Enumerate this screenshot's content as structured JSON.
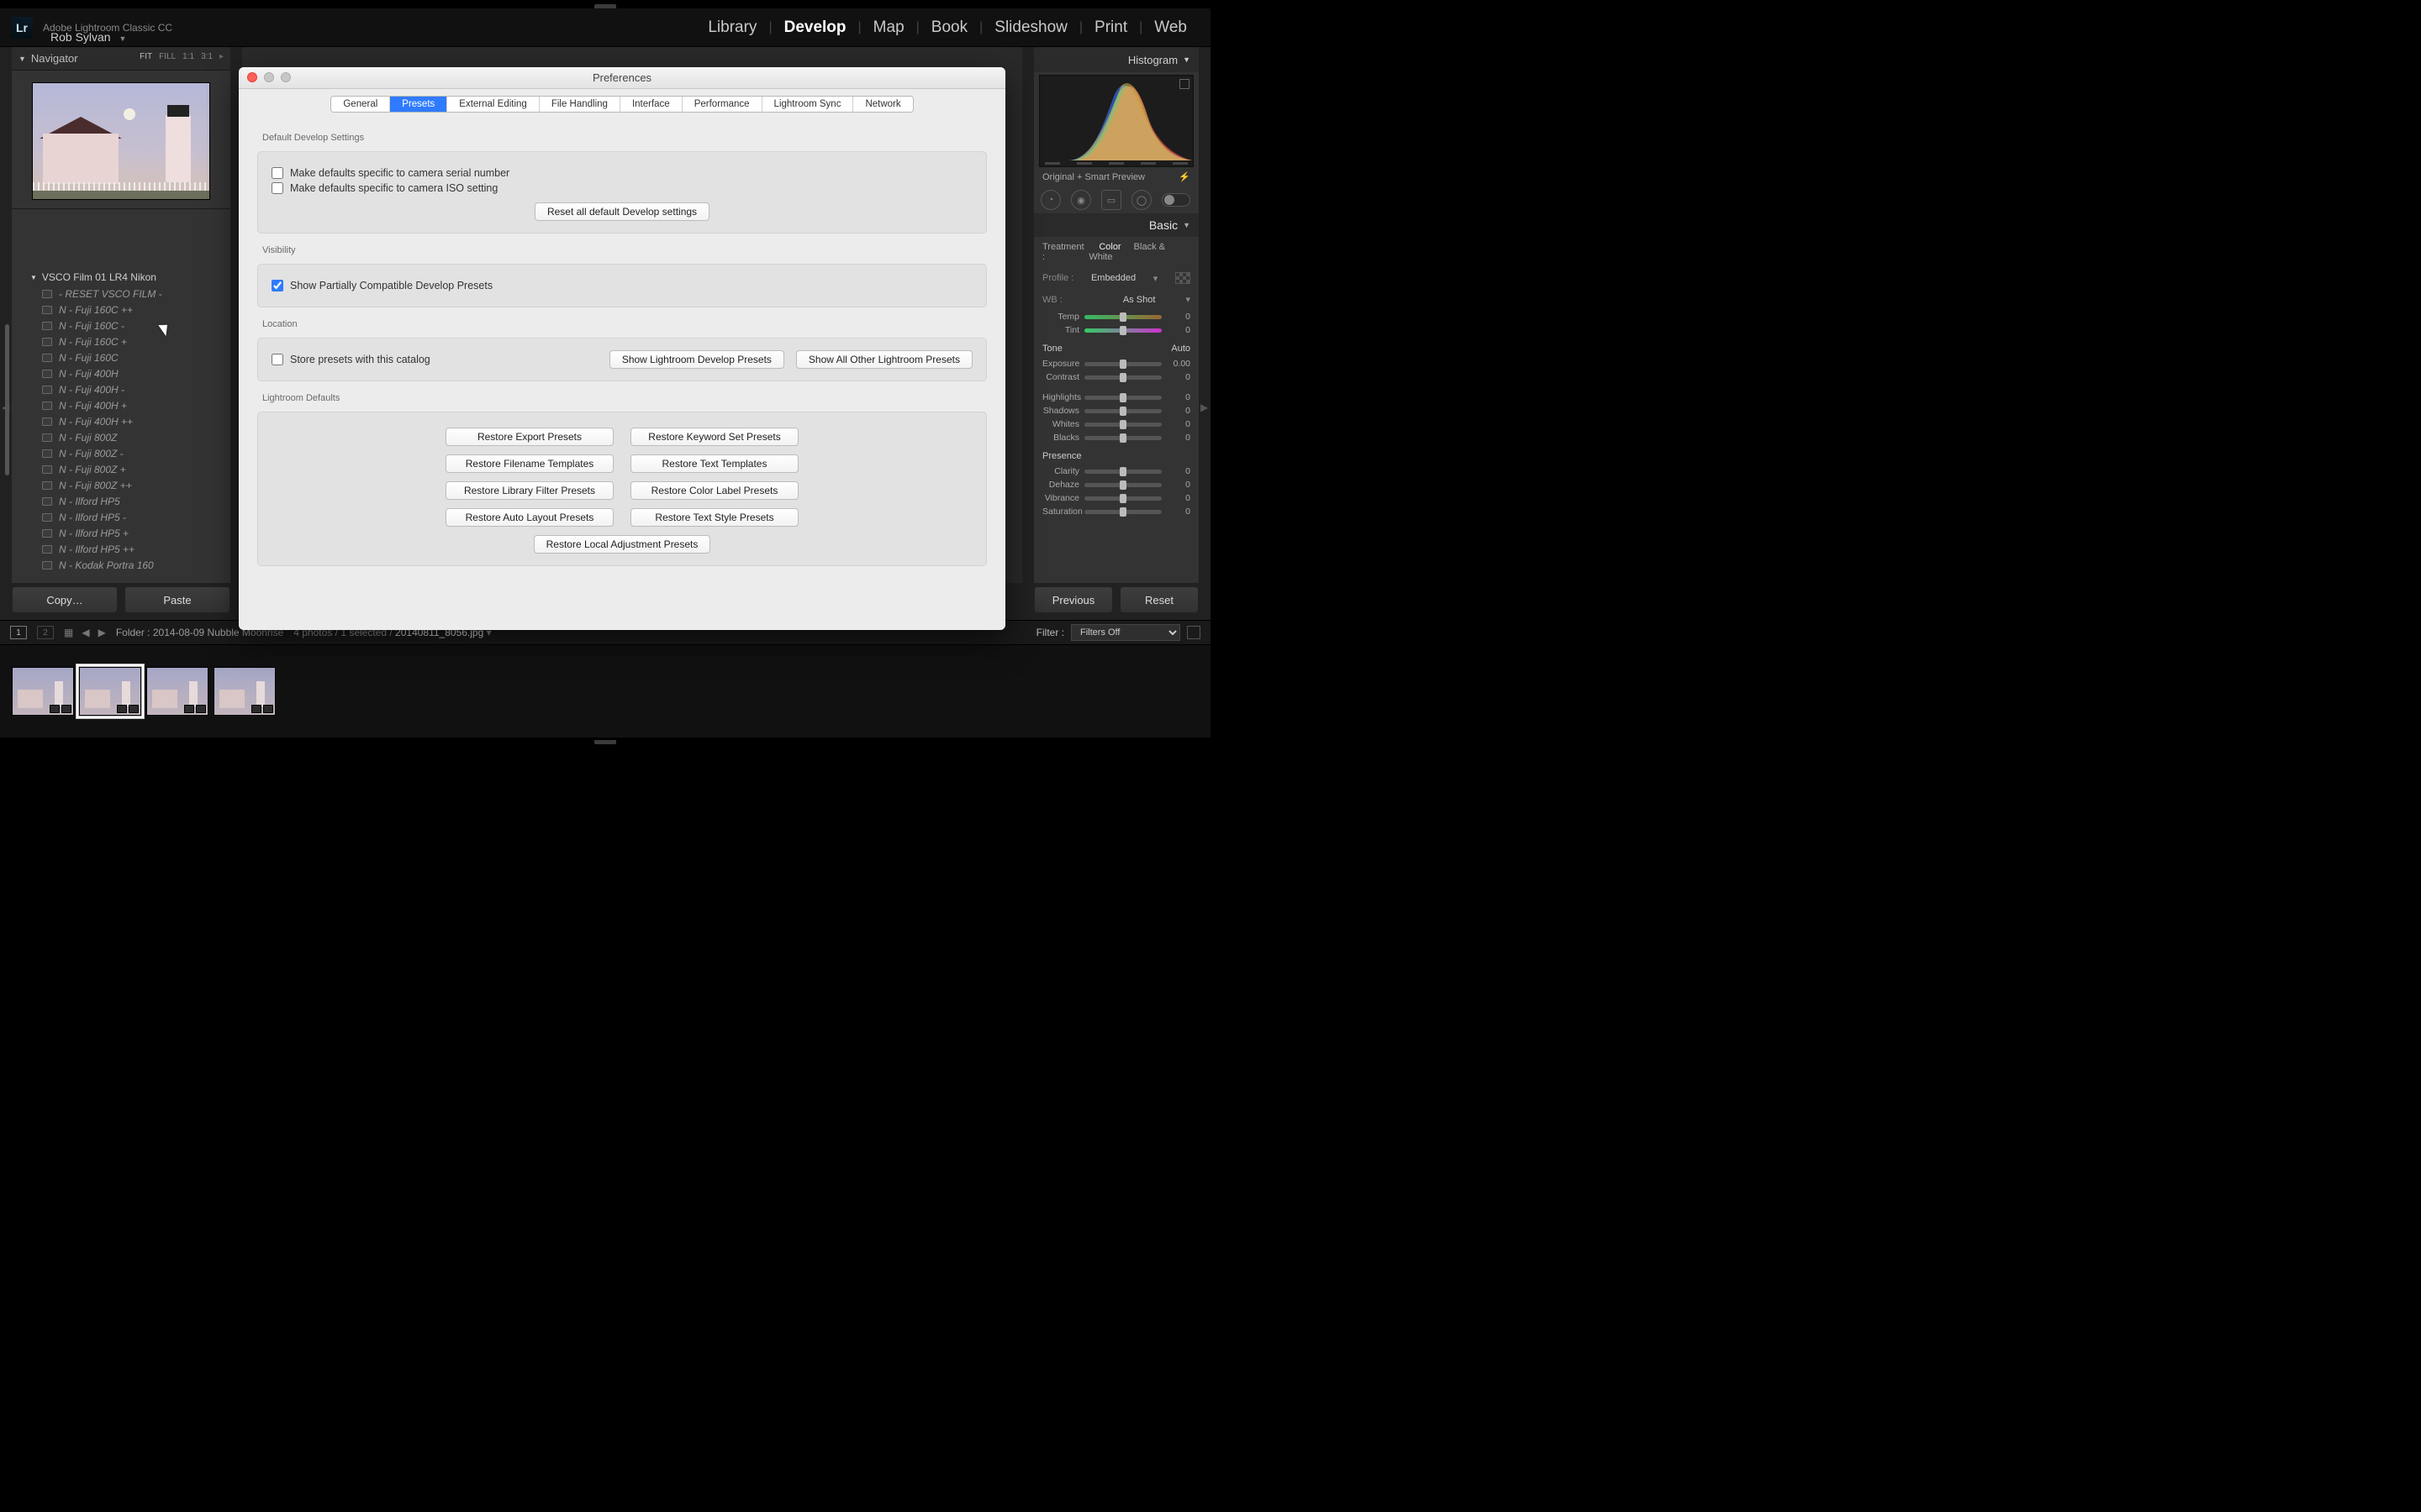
{
  "app": {
    "logo_text": "Lr",
    "title": "Adobe Lightroom Classic CC",
    "user": "Rob Sylvan"
  },
  "modules": [
    "Library",
    "Develop",
    "Map",
    "Book",
    "Slideshow",
    "Print",
    "Web"
  ],
  "active_module": "Develop",
  "navigator": {
    "title": "Navigator",
    "zoom_options": [
      "FIT",
      "FILL",
      "1:1",
      "3:1"
    ]
  },
  "preset_folder": "VSCO Film 01 LR4 Nikon",
  "presets": [
    "- RESET VSCO FILM -",
    "N - Fuji 160C ++",
    "N - Fuji 160C -",
    "N - Fuji 160C +",
    "N - Fuji 160C",
    "N - Fuji 400H",
    "N - Fuji 400H -",
    "N - Fuji 400H +",
    "N - Fuji 400H ++",
    "N - Fuji 800Z",
    "N - Fuji 800Z -",
    "N - Fuji 800Z +",
    "N - Fuji 800Z ++",
    "N - Ilford HP5",
    "N - Ilford HP5 -",
    "N - Ilford HP5 +",
    "N - Ilford HP5 ++",
    "N - Kodak Portra 160"
  ],
  "histogram": {
    "title": "Histogram"
  },
  "preview_label": "Original + Smart Preview",
  "basic_panel": {
    "title": "Basic",
    "treatment_label": "Treatment :",
    "treatments": [
      "Color",
      "Black & White"
    ],
    "profile_label": "Profile :",
    "profile_value": "Embedded",
    "wb_label": "WB :",
    "wb_value": "As Shot",
    "temp_label": "Temp",
    "temp_val": "0",
    "tint_label": "Tint",
    "tint_val": "0",
    "tone_label": "Tone",
    "auto_label": "Auto",
    "exposure_label": "Exposure",
    "exposure_val": "0.00",
    "contrast_label": "Contrast",
    "contrast_val": "0",
    "highlights_label": "Highlights",
    "highlights_val": "0",
    "shadows_label": "Shadows",
    "shadows_val": "0",
    "whites_label": "Whites",
    "whites_val": "0",
    "blacks_label": "Blacks",
    "blacks_val": "0",
    "presence_label": "Presence",
    "clarity_label": "Clarity",
    "clarity_val": "0",
    "dehaze_label": "Dehaze",
    "dehaze_val": "0",
    "vibrance_label": "Vibrance",
    "vibrance_val": "0",
    "saturation_label": "Saturation",
    "saturation_val": "0"
  },
  "buttons": {
    "copy": "Copy…",
    "paste": "Paste",
    "previous": "Previous",
    "reset": "Reset"
  },
  "info_bar": {
    "monitor1": "1",
    "monitor2": "2",
    "folder_label": "Folder :",
    "folder_name": "2014-08-09 Nubble Moonrise",
    "counts": "4 photos / 1 selected /",
    "filename": "20140811_8056.jpg",
    "filter_label": "Filter :",
    "filter_value": "Filters Off"
  },
  "prefs": {
    "title": "Preferences",
    "tabs": [
      "General",
      "Presets",
      "External Editing",
      "File Handling",
      "Interface",
      "Performance",
      "Lightroom Sync",
      "Network"
    ],
    "active_tab": "Presets",
    "section_default": "Default Develop Settings",
    "chk_serial": "Make defaults specific to camera serial number",
    "chk_iso": "Make defaults specific to camera ISO setting",
    "btn_reset_defaults": "Reset all default Develop settings",
    "section_visibility": "Visibility",
    "chk_partial": "Show Partially Compatible Develop Presets",
    "section_location": "Location",
    "chk_store": "Store presets with this catalog",
    "btn_show_develop": "Show Lightroom Develop Presets",
    "btn_show_other": "Show All Other Lightroom Presets",
    "section_lrdefaults": "Lightroom Defaults",
    "btns": {
      "export": "Restore Export Presets",
      "keyword": "Restore Keyword Set Presets",
      "filename": "Restore Filename Templates",
      "text": "Restore Text Templates",
      "library": "Restore Library Filter Presets",
      "color": "Restore Color Label Presets",
      "autolayout": "Restore Auto Layout Presets",
      "textstyle": "Restore Text Style Presets",
      "localadj": "Restore Local Adjustment Presets"
    }
  }
}
